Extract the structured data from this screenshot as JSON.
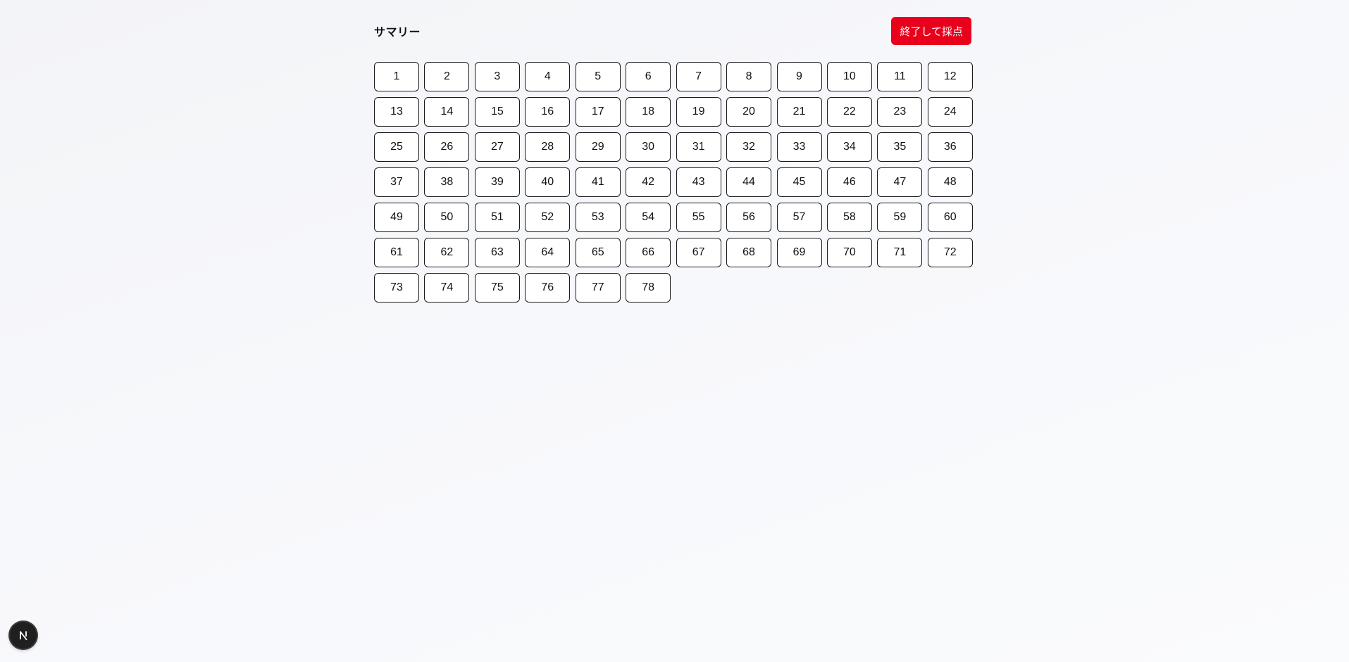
{
  "header": {
    "title": "サマリー",
    "finish_label": "終了して採点"
  },
  "questions": [
    "1",
    "2",
    "3",
    "4",
    "5",
    "6",
    "7",
    "8",
    "9",
    "10",
    "11",
    "12",
    "13",
    "14",
    "15",
    "16",
    "17",
    "18",
    "19",
    "20",
    "21",
    "22",
    "23",
    "24",
    "25",
    "26",
    "27",
    "28",
    "29",
    "30",
    "31",
    "32",
    "33",
    "34",
    "35",
    "36",
    "37",
    "38",
    "39",
    "40",
    "41",
    "42",
    "43",
    "44",
    "45",
    "46",
    "47",
    "48",
    "49",
    "50",
    "51",
    "52",
    "53",
    "54",
    "55",
    "56",
    "57",
    "58",
    "59",
    "60",
    "61",
    "62",
    "63",
    "64",
    "65",
    "66",
    "67",
    "68",
    "69",
    "70",
    "71",
    "72",
    "73",
    "74",
    "75",
    "76",
    "77",
    "78"
  ],
  "dev_indicator": {
    "icon": "nextjs-logo-icon"
  },
  "colors": {
    "accent": "#e8001c",
    "button_border": "#1a1a1a",
    "button_bg": "#ffffff"
  }
}
